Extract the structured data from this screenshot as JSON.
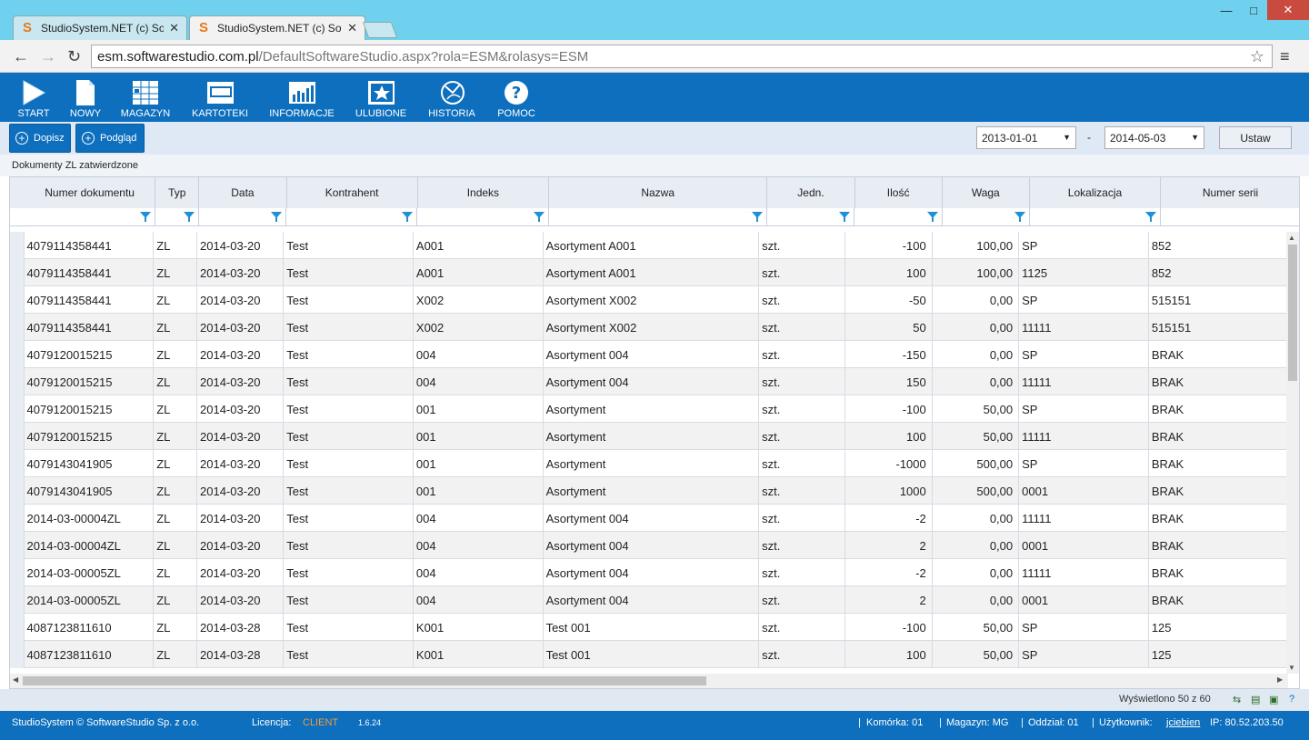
{
  "browser": {
    "tabs": [
      {
        "title": "StudioSystem.NET (c) Soft",
        "active": false
      },
      {
        "title": "StudioSystem.NET (c) Soft",
        "active": true
      }
    ],
    "url_host": "esm.softwarestudio.com.pl",
    "url_path": "/DefaultSoftwareStudio.aspx?rola=ESM&rolasys=ESM"
  },
  "toolbar": {
    "items": [
      {
        "label": "START",
        "icon": "play-icon"
      },
      {
        "label": "NOWY",
        "icon": "new-document-icon"
      },
      {
        "label": "MAGAZYN",
        "icon": "warehouse-grid-icon"
      },
      {
        "label": "KARTOTEKI",
        "icon": "card-file-icon"
      },
      {
        "label": "INFORMACJE",
        "icon": "chart-icon"
      },
      {
        "label": "ULUBIONE",
        "icon": "star-icon"
      },
      {
        "label": "HISTORIA",
        "icon": "history-icon"
      },
      {
        "label": "POMOC",
        "icon": "help-icon"
      }
    ]
  },
  "actions": {
    "dopisz": "Dopisz",
    "podglad": "Podgląd",
    "date_from": "2013-01-01",
    "date_sep": "-",
    "date_to": "2014-05-03",
    "ustaw": "Ustaw"
  },
  "grid": {
    "title": "Dokumenty ZL zatwierdzone",
    "columns": [
      "Numer dokumentu",
      "Typ",
      "Data",
      "Kontrahent",
      "Indeks",
      "Nazwa",
      "Jedn.",
      "Ilość",
      "Waga",
      "Lokalizacja",
      "Numer serii"
    ],
    "rows": [
      [
        "4079114358441",
        "ZL",
        "2014-03-20",
        "Test",
        "A001",
        "Asortyment A001",
        "szt.",
        "-100",
        "100,00",
        "SP",
        "852"
      ],
      [
        "4079114358441",
        "ZL",
        "2014-03-20",
        "Test",
        "A001",
        "Asortyment A001",
        "szt.",
        "100",
        "100,00",
        "1125",
        "852"
      ],
      [
        "4079114358441",
        "ZL",
        "2014-03-20",
        "Test",
        "X002",
        "Asortyment X002",
        "szt.",
        "-50",
        "0,00",
        "SP",
        "515151"
      ],
      [
        "4079114358441",
        "ZL",
        "2014-03-20",
        "Test",
        "X002",
        "Asortyment X002",
        "szt.",
        "50",
        "0,00",
        "11111",
        "515151"
      ],
      [
        "4079120015215",
        "ZL",
        "2014-03-20",
        "Test",
        "004",
        "Asortyment 004",
        "szt.",
        "-150",
        "0,00",
        "SP",
        "BRAK"
      ],
      [
        "4079120015215",
        "ZL",
        "2014-03-20",
        "Test",
        "004",
        "Asortyment 004",
        "szt.",
        "150",
        "0,00",
        "11111",
        "BRAK"
      ],
      [
        "4079120015215",
        "ZL",
        "2014-03-20",
        "Test",
        "001",
        "Asortyment",
        "szt.",
        "-100",
        "50,00",
        "SP",
        "BRAK"
      ],
      [
        "4079120015215",
        "ZL",
        "2014-03-20",
        "Test",
        "001",
        "Asortyment",
        "szt.",
        "100",
        "50,00",
        "11111",
        "BRAK"
      ],
      [
        "4079143041905",
        "ZL",
        "2014-03-20",
        "Test",
        "001",
        "Asortyment",
        "szt.",
        "-1000",
        "500,00",
        "SP",
        "BRAK"
      ],
      [
        "4079143041905",
        "ZL",
        "2014-03-20",
        "Test",
        "001",
        "Asortyment",
        "szt.",
        "1000",
        "500,00",
        "0001",
        "BRAK"
      ],
      [
        "2014-03-00004ZL",
        "ZL",
        "2014-03-20",
        "Test",
        "004",
        "Asortyment 004",
        "szt.",
        "-2",
        "0,00",
        "11111",
        "BRAK"
      ],
      [
        "2014-03-00004ZL",
        "ZL",
        "2014-03-20",
        "Test",
        "004",
        "Asortyment 004",
        "szt.",
        "2",
        "0,00",
        "0001",
        "BRAK"
      ],
      [
        "2014-03-00005ZL",
        "ZL",
        "2014-03-20",
        "Test",
        "004",
        "Asortyment 004",
        "szt.",
        "-2",
        "0,00",
        "11111",
        "BRAK"
      ],
      [
        "2014-03-00005ZL",
        "ZL",
        "2014-03-20",
        "Test",
        "004",
        "Asortyment 004",
        "szt.",
        "2",
        "0,00",
        "0001",
        "BRAK"
      ],
      [
        "4087123811610",
        "ZL",
        "2014-03-28",
        "Test",
        "K001",
        "Test 001",
        "szt.",
        "-100",
        "50,00",
        "SP",
        "125"
      ],
      [
        "4087123811610",
        "ZL",
        "2014-03-28",
        "Test",
        "K001",
        "Test 001",
        "szt.",
        "100",
        "50,00",
        "SP",
        "125"
      ]
    ]
  },
  "pager": {
    "text": "Wyświetlono 50 z 60"
  },
  "status": {
    "copyright": "StudioSystem © SoftwareStudio Sp. z o.o.",
    "license_label": "Licencja:",
    "license_value": "CLIENT",
    "version": "1.6.24",
    "komorka": "Komórka: 01",
    "magazyn": "Magazyn: MG",
    "oddzial": "Oddział: 01",
    "user_label": "Użytkownik:",
    "user": "jciebien",
    "ip": "IP: 80.52.203.50"
  }
}
